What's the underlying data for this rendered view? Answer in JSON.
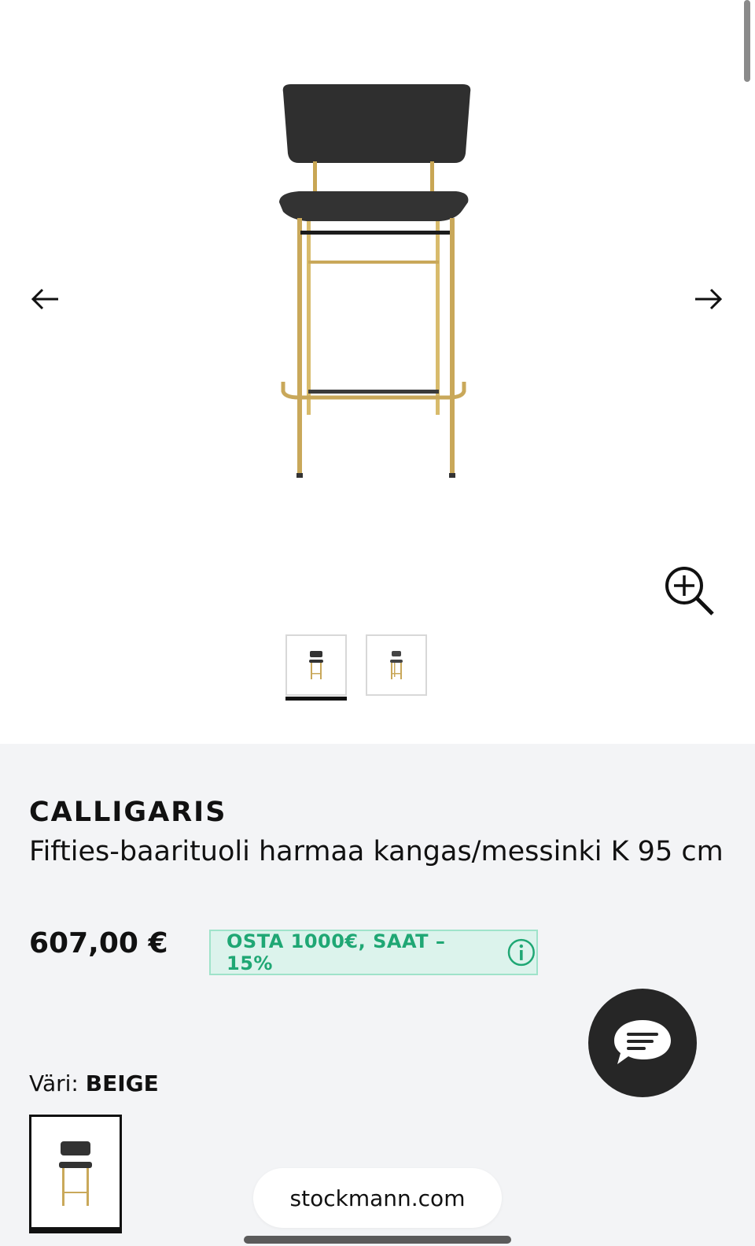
{
  "product": {
    "brand": "CALLIGARIS",
    "title": "Fifties-baarituoli harmaa kangas/messinki K 95 cm",
    "price": "607,00 €",
    "promo_text": "OSTA 1000€, SAAT –15%",
    "color_label": "Väri:",
    "color_value": "BEIGE"
  },
  "gallery": {
    "thumbnails": [
      "thumb-1",
      "thumb-2"
    ],
    "active_thumbnail": 1
  },
  "browser": {
    "url": "stockmann.com"
  },
  "icons": {
    "prev": "arrow-left-icon",
    "next": "arrow-right-icon",
    "zoom": "zoom-in-icon",
    "promo_info": "info-icon",
    "chat": "chat-icon"
  },
  "colors": {
    "promo_text": "#1fa774",
    "promo_bg": "#dcf3ec",
    "info_bg": "#f3f4f6",
    "chat_bg": "#262626"
  }
}
